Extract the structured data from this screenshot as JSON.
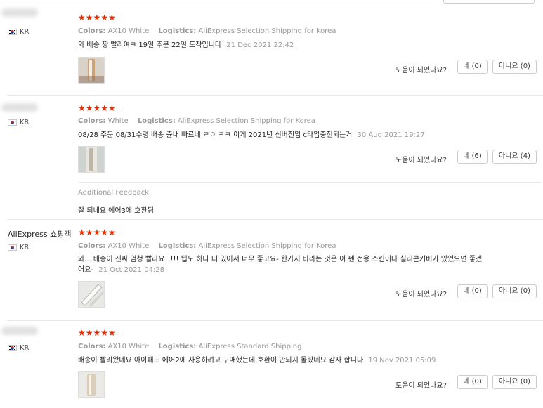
{
  "helpful_label": "도움이 되었나요?",
  "reviews": [
    {
      "user": "",
      "country": "KR",
      "stars": "★★★★★",
      "colors_label": "Colors:",
      "colors_value": "AX10 White",
      "logistics_label": "Logistics:",
      "logistics_value": "AliExpress Selection Shipping for Korea",
      "content": "와 배송 짱 빨라여ㅋ 19일 주문 22일 도착입니다",
      "date": "21 Dec 2021 22:42",
      "yes": "네 (0)",
      "no": "아니요 (0)"
    },
    {
      "user": "",
      "country": "KR",
      "stars": "★★★★★",
      "colors_label": "Colors:",
      "colors_value": "White",
      "logistics_label": "Logistics:",
      "logistics_value": "AliExpress Selection Shipping for Korea",
      "content": "08/28 주문 08/31수령 배송 쥰내 빠르네 ㄹㅇ ㅋㅋ 이게 2021년 신버전임 c타입충전되는거",
      "date": "30 Aug 2021 19:27",
      "yes": "네 (6)",
      "no": "아니요 (4)",
      "additional_feedback_title": "Additional Feedback",
      "additional_feedback": "잘 되네요 에어3에 호환됨"
    },
    {
      "user": "AliExpress 쇼핑객",
      "country": "KR",
      "stars": "★★★★★",
      "colors_label": "Colors:",
      "colors_value": "AX10 White",
      "logistics_label": "Logistics:",
      "logistics_value": "AliExpress Selection Shipping for Korea",
      "content": "와... 배송이 진짜 엄청 빨라요!!!!! 팁도 하나 더 있어서 너무 좋고요- 한가지 바라는 것은 이 펜 전용 스킨이나 실리콘커버가 있었으면 좋겠어요-",
      "date": "21 Oct 2021 04:28",
      "yes": "네 (0)",
      "no": "아니요 (0)"
    },
    {
      "user": "",
      "country": "KR",
      "stars": "★★★★★",
      "colors_label": "Colors:",
      "colors_value": "AX10 White",
      "logistics_label": "Logistics:",
      "logistics_value": "AliExpress Standard Shipping",
      "content": "배송이 빨리왔네요 아이패드 에어2에 사용하려고 구매했는데 호환이 안되지 몰랐네요 감사 합니다",
      "date": "19 Nov 2021 05:09",
      "yes": "네 (0)",
      "no": "아니요 (0)"
    }
  ]
}
